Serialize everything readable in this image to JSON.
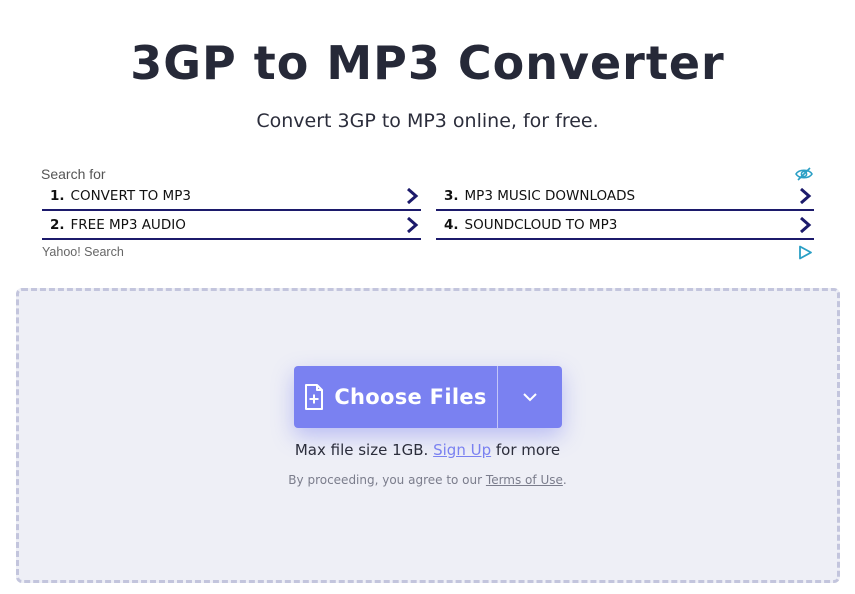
{
  "header": {
    "title": "3GP to MP3 Converter",
    "subtitle": "Convert 3GP to MP3 online, for free."
  },
  "ad": {
    "search_for": "Search for",
    "items": [
      {
        "num": "1.",
        "label": "CONVERT TO MP3"
      },
      {
        "num": "2.",
        "label": "FREE MP3 AUDIO"
      },
      {
        "num": "3.",
        "label": "MP3 MUSIC DOWNLOADS"
      },
      {
        "num": "4.",
        "label": "SOUNDCLOUD TO MP3"
      }
    ],
    "provider": "Yahoo! Search",
    "icons": [
      "eye-icon",
      "chevron-right-icon",
      "ad-choices-icon"
    ],
    "colors": {
      "underline": "#1c1a6b",
      "icon": "#2a9fc5"
    }
  },
  "upload": {
    "button_label": "Choose Files",
    "icons": [
      "file-plus-icon",
      "chevron-down-icon"
    ],
    "max_size_text": "Max file size 1GB.",
    "signup_link": "Sign Up",
    "max_size_suffix": "for more",
    "terms_prefix": "By proceeding, you agree to our",
    "terms_link": "Terms of Use",
    "terms_suffix": ".",
    "colors": {
      "accent": "#7a81f1",
      "dropzone_bg": "#eeeff6",
      "dropzone_border": "#c3c5dd"
    }
  }
}
